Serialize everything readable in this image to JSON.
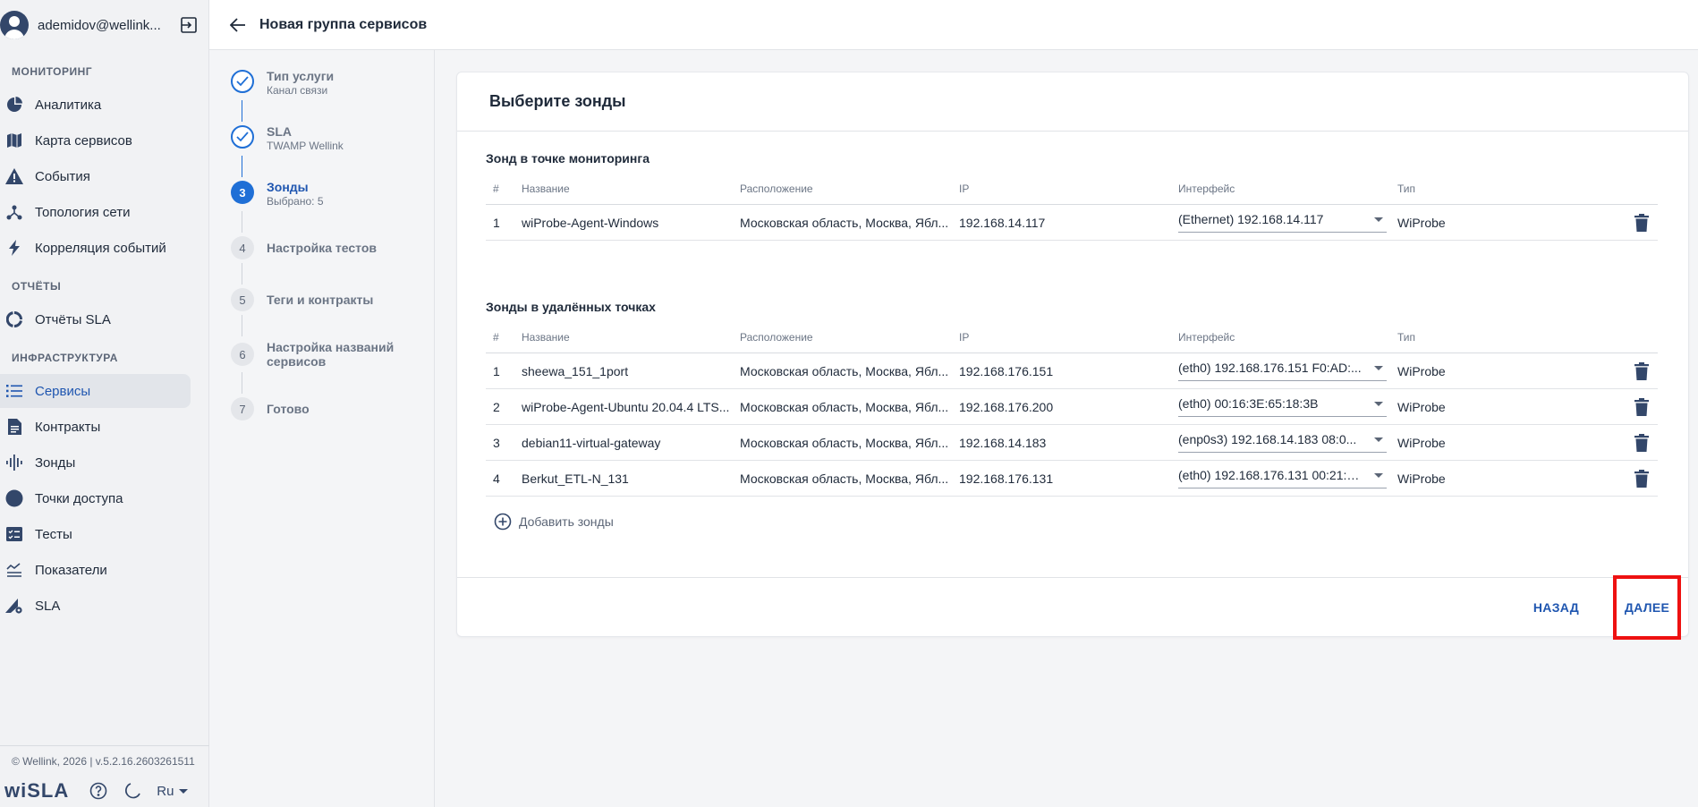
{
  "user": {
    "name": "ademidov@wellink..."
  },
  "sidebar": {
    "sections": [
      {
        "title": "МОНИТОРИНГ",
        "items": [
          {
            "label": "Аналитика",
            "icon": "pie-chart-icon"
          },
          {
            "label": "Карта сервисов",
            "icon": "map-icon"
          },
          {
            "label": "События",
            "icon": "warning-icon"
          },
          {
            "label": "Топология сети",
            "icon": "topology-icon"
          },
          {
            "label": "Корреляция событий",
            "icon": "lightning-icon"
          }
        ]
      },
      {
        "title": "ОТЧЁТЫ",
        "items": [
          {
            "label": "Отчёты SLA",
            "icon": "ring-chart-icon"
          }
        ]
      },
      {
        "title": "ИНФРАСТРУКТУРА",
        "items": [
          {
            "label": "Сервисы",
            "icon": "list-icon",
            "active": true
          },
          {
            "label": "Контракты",
            "icon": "document-icon"
          },
          {
            "label": "Зонды",
            "icon": "waveform-icon"
          },
          {
            "label": "Точки доступа",
            "icon": "circle-icon"
          },
          {
            "label": "Тесты",
            "icon": "checklist-icon"
          },
          {
            "label": "Показатели",
            "icon": "metrics-icon"
          },
          {
            "label": "SLA",
            "icon": "sla-gear-icon"
          }
        ]
      }
    ],
    "copyright": "© Wellink, 2026 | v.5.2.16.2603261511",
    "logo": "wiSLA",
    "lang": "Ru"
  },
  "topbar": {
    "title": "Новая группа сервисов"
  },
  "stepper": {
    "steps": [
      {
        "num": "1",
        "label": "Тип услуги",
        "sub": "Канал связи",
        "state": "done"
      },
      {
        "num": "2",
        "label": "SLA",
        "sub": "TWAMP Wellink",
        "state": "done"
      },
      {
        "num": "3",
        "label": "Зонды",
        "sub": "Выбрано: 5",
        "state": "current"
      },
      {
        "num": "4",
        "label": "Настройка тестов",
        "sub": "",
        "state": "todo"
      },
      {
        "num": "5",
        "label": "Теги и контракты",
        "sub": "",
        "state": "todo"
      },
      {
        "num": "6",
        "label": "Настройка названий сервисов",
        "sub": "",
        "state": "todo"
      },
      {
        "num": "7",
        "label": "Готово",
        "sub": "",
        "state": "todo"
      }
    ]
  },
  "card": {
    "title": "Выберите зонды",
    "columns": {
      "num": "#",
      "name": "Название",
      "location": "Расположение",
      "ip": "IP",
      "interface": "Интерфейс",
      "type": "Тип"
    },
    "monitoring": {
      "title": "Зонд в точке мониторинга",
      "rows": [
        {
          "num": "1",
          "name": "wiProbe-Agent-Windows",
          "location": "Московская область, Москва, Ябл...",
          "ip": "192.168.14.117",
          "interface": "(Ethernet) 192.168.14.117",
          "type": "WiProbe"
        }
      ]
    },
    "remote": {
      "title": "Зонды в удалённых точках",
      "rows": [
        {
          "num": "1",
          "name": "sheewa_151_1port",
          "location": "Московская область, Москва, Ябл...",
          "ip": "192.168.176.151",
          "interface": "(eth0) 192.168.176.151 F0:AD:...",
          "type": "WiProbe"
        },
        {
          "num": "2",
          "name": "wiProbe-Agent-Ubuntu 20.04.4 LTS...",
          "location": "Московская область, Москва, Ябл...",
          "ip": "192.168.176.200",
          "interface": "(eth0) 00:16:3E:65:18:3B",
          "type": "WiProbe"
        },
        {
          "num": "3",
          "name": "debian11-virtual-gateway",
          "location": "Московская область, Москва, Ябл...",
          "ip": "192.168.14.183",
          "interface": "(enp0s3) 192.168.14.183 08:0...",
          "type": "WiProbe"
        },
        {
          "num": "4",
          "name": "Berkut_ETL-N_131",
          "location": "Московская область, Москва, Ябл...",
          "ip": "192.168.176.131",
          "interface": "(eth0) 192.168.176.131 00:21:C...",
          "type": "WiProbe"
        }
      ]
    },
    "add_label": "Добавить зонды",
    "back_label": "НАЗАД",
    "next_label": "ДАЛЕЕ"
  },
  "colors": {
    "accent": "#1f56b0",
    "highlight": "#ee1111",
    "active_bg": "#e2e5ea"
  }
}
